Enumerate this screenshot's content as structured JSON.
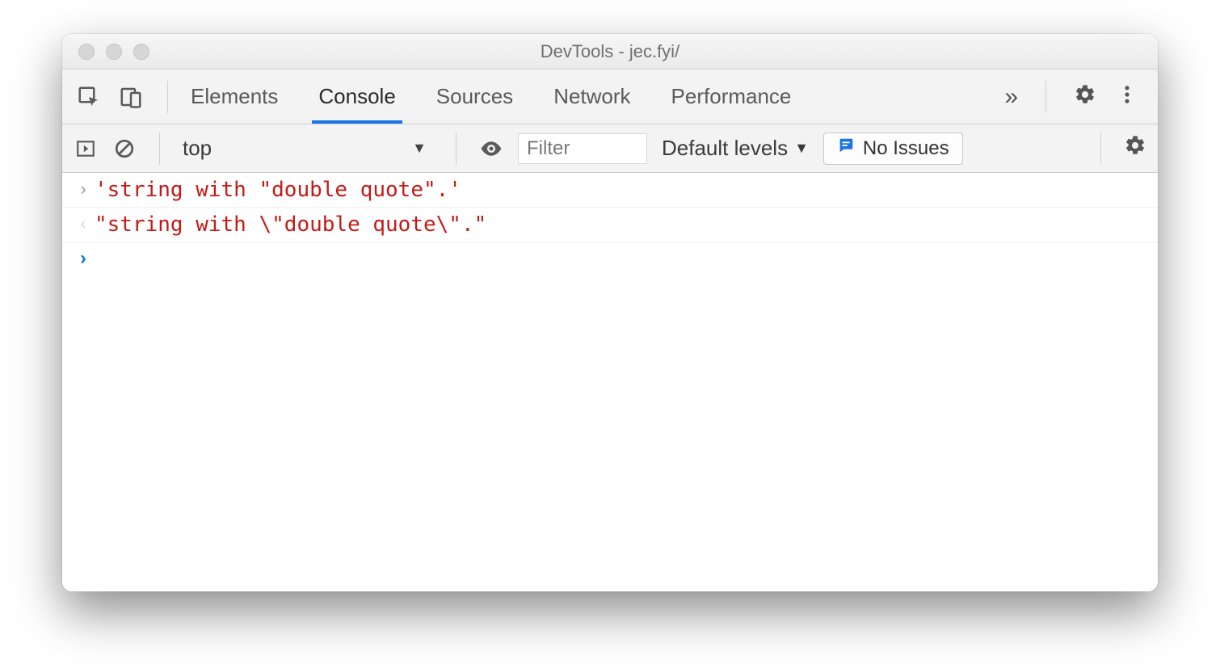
{
  "window": {
    "title": "DevTools - jec.fyi/"
  },
  "tabs": {
    "items": [
      "Elements",
      "Console",
      "Sources",
      "Network",
      "Performance"
    ],
    "activeIndex": 1,
    "overflowGlyph": "»"
  },
  "toolbar": {
    "context": "top",
    "filterPlaceholder": "Filter",
    "levelsLabel": "Default levels",
    "issuesLabel": "No Issues"
  },
  "console": {
    "lines": [
      {
        "kind": "input",
        "text": "'string with \"double quote\".'"
      },
      {
        "kind": "output",
        "text": "\"string with \\\"double quote\\\".\""
      }
    ]
  }
}
